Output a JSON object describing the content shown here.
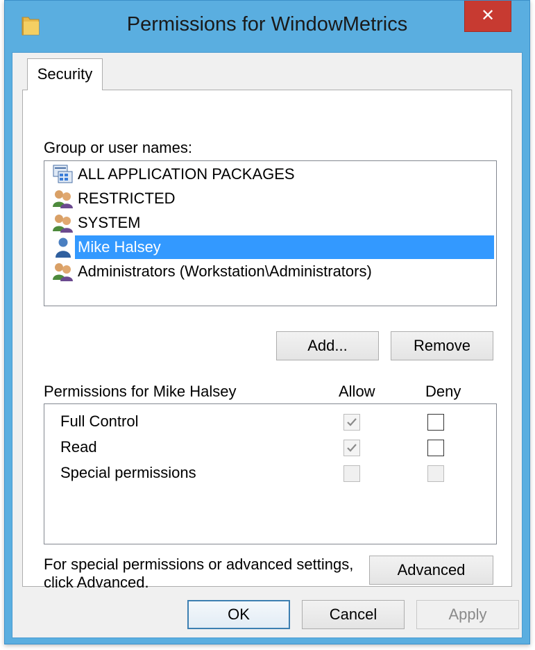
{
  "window": {
    "title": "Permissions for WindowMetrics",
    "close_glyph": "✕",
    "icon": "folder-icon"
  },
  "tabs": [
    {
      "label": "Security",
      "active": true
    }
  ],
  "users": {
    "label": "Group or user names:",
    "items": [
      {
        "name": "ALL APPLICATION PACKAGES",
        "icon": "app-packages-icon",
        "selected": false
      },
      {
        "name": "RESTRICTED",
        "icon": "user-group-icon",
        "selected": false
      },
      {
        "name": "SYSTEM",
        "icon": "user-group-icon",
        "selected": false
      },
      {
        "name": "Mike Halsey",
        "icon": "user-icon",
        "selected": true
      },
      {
        "name": "Administrators (Workstation\\Administrators)",
        "icon": "user-group-icon",
        "selected": false
      }
    ],
    "add_label": "Add...",
    "remove_label": "Remove"
  },
  "permissions": {
    "label": "Permissions for Mike Halsey",
    "allow_header": "Allow",
    "deny_header": "Deny",
    "rows": [
      {
        "name": "Full Control",
        "allow": "checked-disabled",
        "deny": "unchecked"
      },
      {
        "name": "Read",
        "allow": "checked-disabled",
        "deny": "unchecked"
      },
      {
        "name": "Special permissions",
        "allow": "disabled",
        "deny": "disabled"
      }
    ]
  },
  "advanced": {
    "note_line1": "For special permissions or advanced settings,",
    "note_line2": "click Advanced.",
    "button_label": "Advanced"
  },
  "footer": {
    "ok_label": "OK",
    "cancel_label": "Cancel",
    "apply_label": "Apply"
  },
  "colors": {
    "title_bar": "#5aaee0",
    "close_button": "#c73a31",
    "selection": "#3399ff"
  }
}
